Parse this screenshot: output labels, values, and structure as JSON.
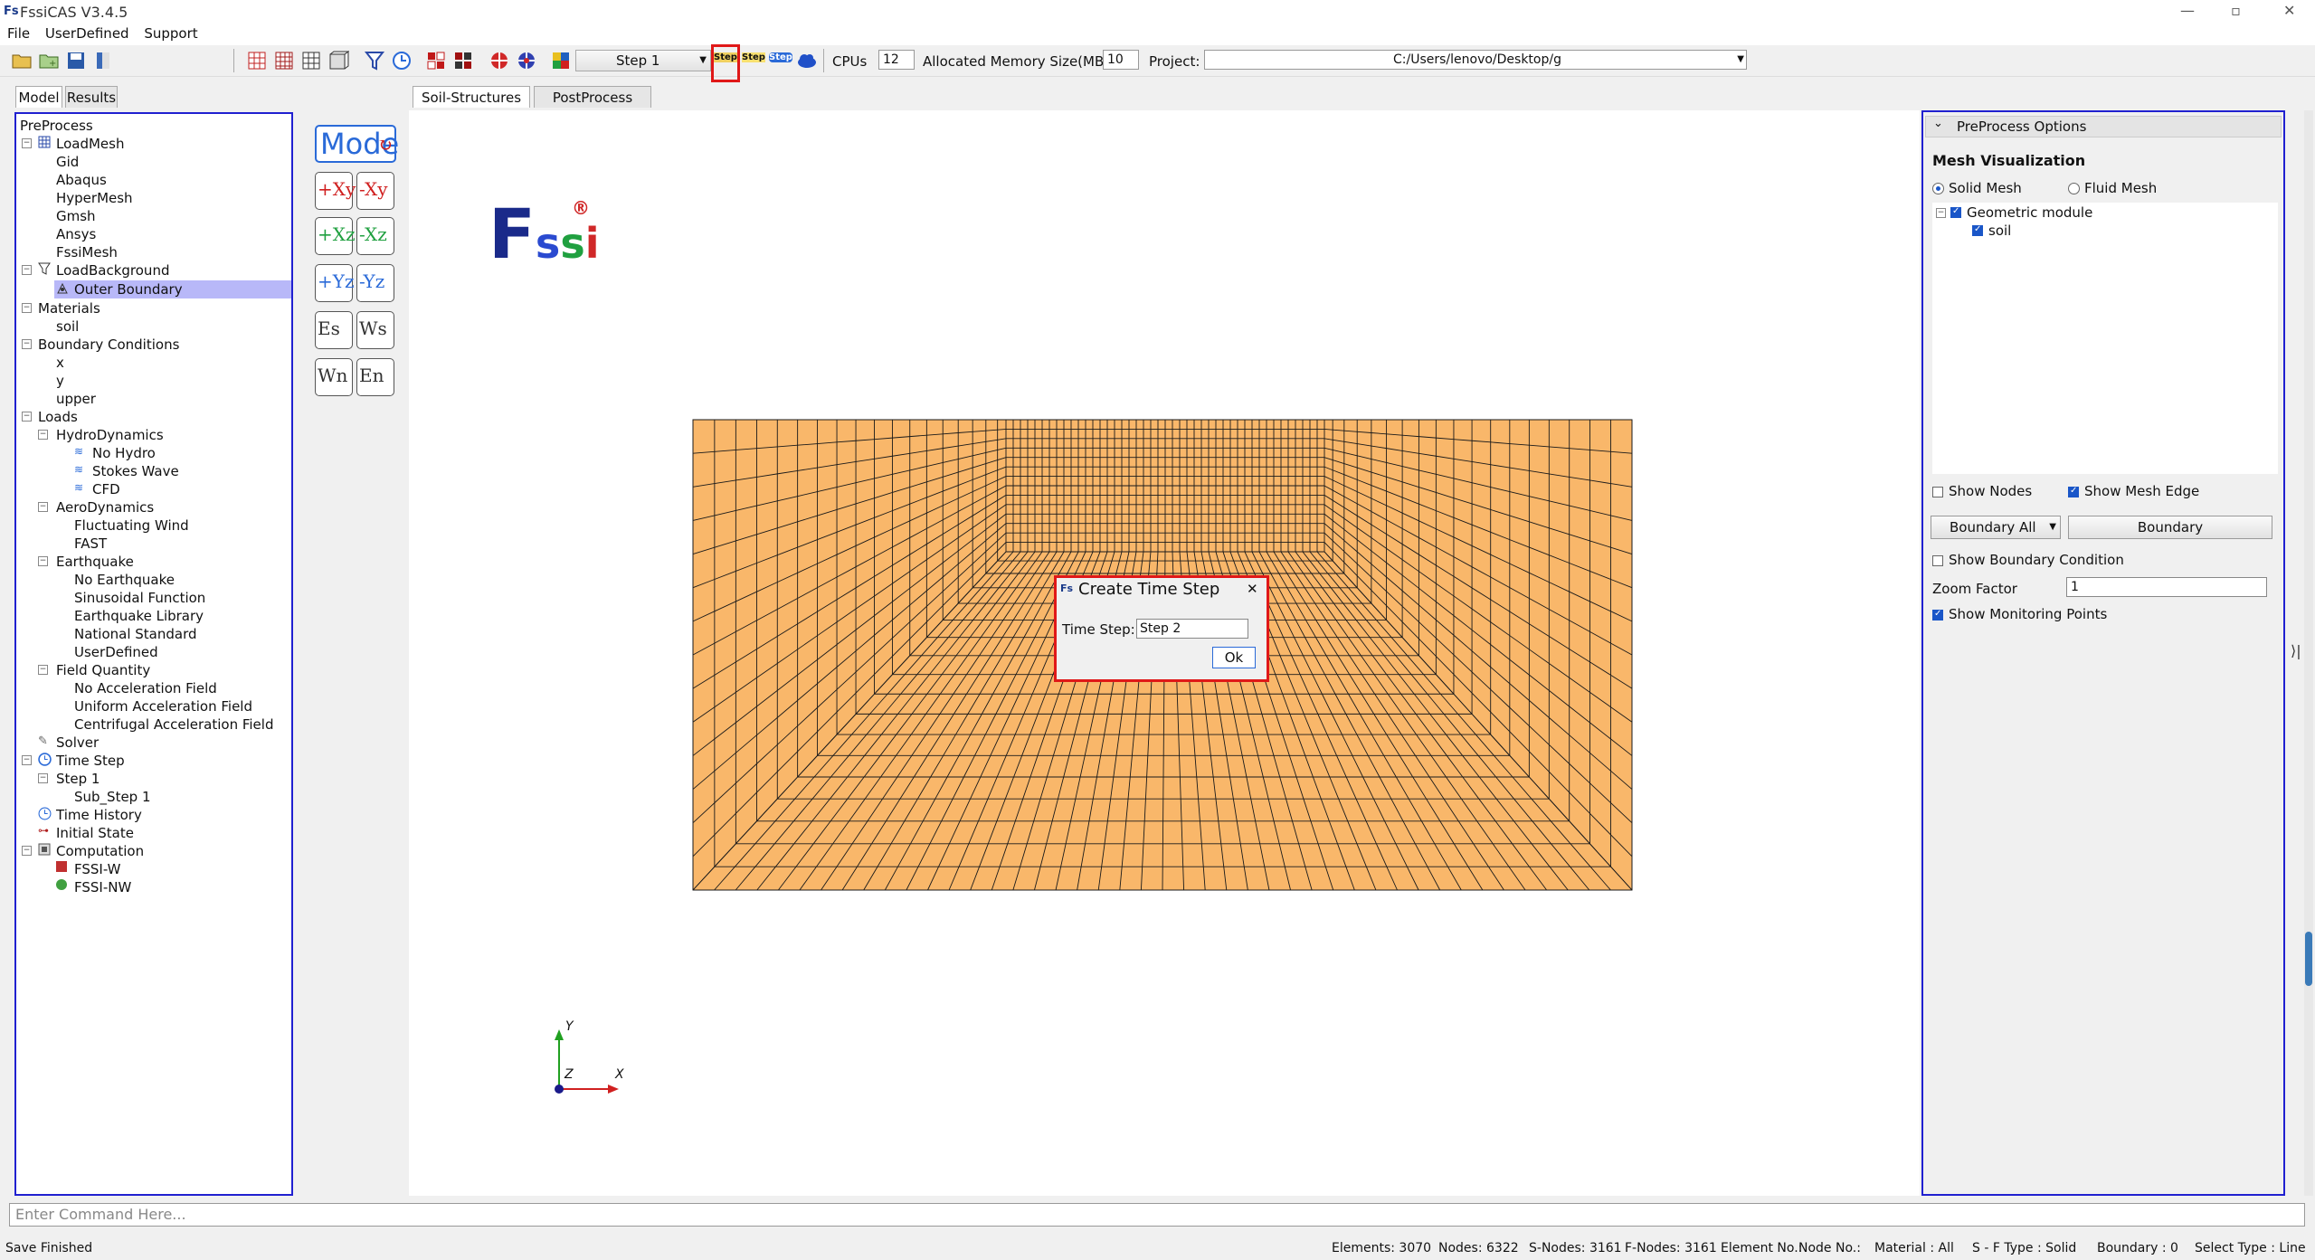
{
  "window": {
    "title": "FssiCAS V3.4.5",
    "logo_text": "Fs"
  },
  "menu": {
    "items": [
      "File",
      "UserDefined",
      "Support"
    ]
  },
  "toolbar": {
    "step_combo": "Step 1",
    "step_btn_1": "Step",
    "step_btn_2": "Step",
    "step_btn_3": "Step",
    "cpus_label": "CPUs",
    "cpus_value": "12",
    "memory_label": "Allocated Memory Size(MB) :",
    "memory_value": "10",
    "project_label": "Project:",
    "project_value": "C:/Users/lenovo/Desktop/g"
  },
  "left_tabs": [
    "Model",
    "Results"
  ],
  "view_tabs": [
    "Soil-Structures",
    "PostProcess"
  ],
  "tree": {
    "root": "PreProcess",
    "loadmesh": "LoadMesh",
    "loadmesh_items": [
      "Gid",
      "Abaqus",
      "HyperMesh",
      "Gmsh",
      "Ansys",
      "FssiMesh"
    ],
    "loadbackground": "LoadBackground",
    "outer_boundary": "Outer Boundary",
    "materials": "Materials",
    "soil": "soil",
    "boundary_conditions": "Boundary Conditions",
    "bc_items": [
      "x",
      "y",
      "upper"
    ],
    "loads": "Loads",
    "hydro": "HydroDynamics",
    "hydro_items": [
      "No Hydro",
      "Stokes Wave",
      "CFD"
    ],
    "aero": "AeroDynamics",
    "aero_items": [
      "Fluctuating Wind",
      "FAST"
    ],
    "earthquake": "Earthquake",
    "eq_items": [
      "No Earthquake",
      "Sinusoidal Function",
      "Earthquake Library",
      "National Standard",
      "UserDefined"
    ],
    "field": "Field Quantity",
    "field_items": [
      "No Acceleration Field",
      "Uniform Acceleration Field",
      "Centrifugal Acceleration Field"
    ],
    "solver": "Solver",
    "time_step": "Time Step",
    "step1": "Step 1",
    "sub_step": "Sub_Step 1",
    "time_history": "Time History",
    "initial_state": "Initial State",
    "computation": "Computation",
    "comp_items": [
      "FSSI-W",
      "FSSI-NW"
    ]
  },
  "side_buttons": {
    "model": "Mode",
    "pairs": [
      [
        "+Xy",
        "-Xy"
      ],
      [
        "+Xz",
        "-Xz"
      ],
      [
        "+Yz",
        "-Yz"
      ],
      [
        "Es",
        "Ws"
      ],
      [
        "Wn",
        "En"
      ]
    ]
  },
  "logo": {
    "f": "F",
    "s1": "s",
    "s2": "s",
    "i": "i",
    "reg": "®"
  },
  "axes": {
    "y": "Y",
    "z": "Z",
    "x": "X"
  },
  "dialog": {
    "icon": "Fs",
    "title": "Create Time Step",
    "close": "✕",
    "field_label": "Time Step:",
    "field_value": "Step 2",
    "ok": "Ok"
  },
  "options": {
    "header": "PreProcess Options",
    "section": "Mesh Visualization",
    "solid_mesh": "Solid Mesh",
    "fluid_mesh": "Fluid Mesh",
    "geo_module": "Geometric module",
    "geo_soil": "soil",
    "show_nodes": "Show Nodes",
    "show_mesh_edge": "Show Mesh Edge",
    "boundary_all": "Boundary All",
    "boundary": "Boundary",
    "show_bc": "Show Boundary Condition",
    "zoom_label": "Zoom Factor",
    "zoom_value": "1",
    "show_monitor": "Show Monitoring Points"
  },
  "command": {
    "placeholder": "Enter Command Here..."
  },
  "status": {
    "left": "Save Finished",
    "elements": "Elements: 3070",
    "nodes": "Nodes: 6322",
    "snodes": "S-Nodes: 3161",
    "fnodes": "F-Nodes: 3161",
    "element_no": "Element No.:",
    "node_no": "Node No.:",
    "material": "Material :  All",
    "sf_type": "S - F Type :  Solid",
    "boundary": "Boundary :  0",
    "select_type": "Select Type :  Line"
  },
  "colors": {
    "mesh_fill": "#f9b76a",
    "mesh_line": "#1a1a1a",
    "highlight": "#e01818",
    "panel_border": "#2020d0"
  }
}
